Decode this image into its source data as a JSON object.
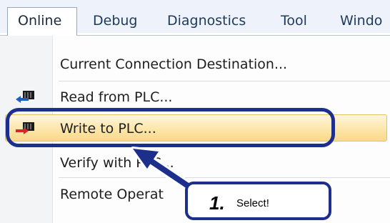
{
  "menubar": {
    "tabs": [
      "Online",
      "Debug",
      "Diagnostics",
      "Tool",
      "Windo"
    ]
  },
  "menu": {
    "items": [
      {
        "label": "Current Connection Destination...",
        "icon": null
      },
      {
        "label": "Read from PLC...",
        "icon": "read-from-plc-icon"
      },
      {
        "label": "Write to PLC...",
        "icon": "write-to-plc-icon",
        "highlighted": true
      },
      {
        "label": "Verify with PLC...",
        "icon": null
      },
      {
        "label": "Remote Operat",
        "icon": null
      }
    ]
  },
  "annotation": {
    "step_number": "1.",
    "instruction": "Select!",
    "color": "#1d2f8c"
  }
}
